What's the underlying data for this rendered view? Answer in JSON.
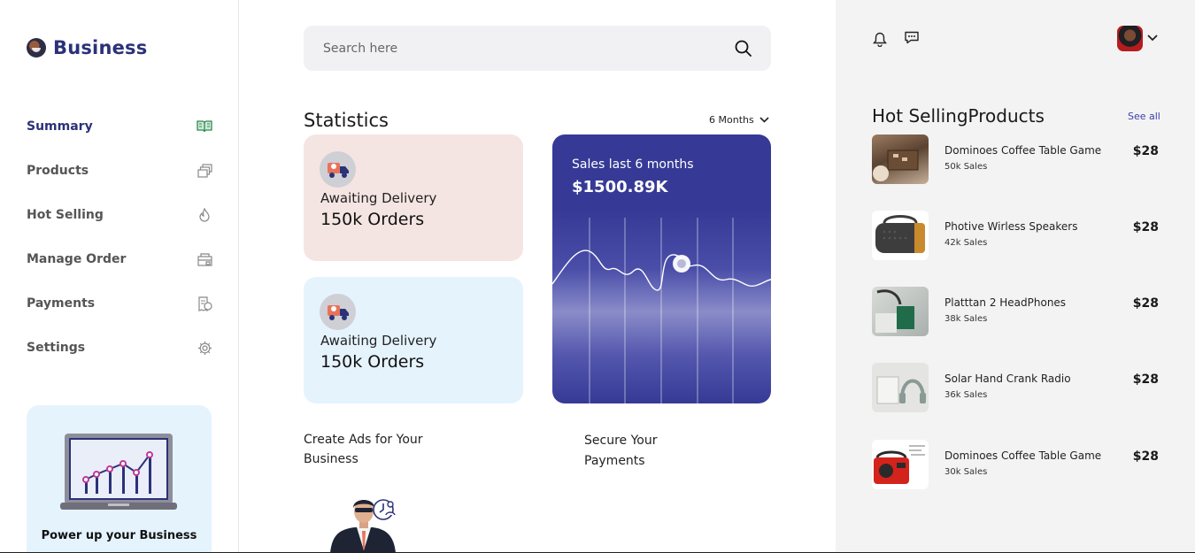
{
  "brand": {
    "name": "Business"
  },
  "sidebar": {
    "items": [
      {
        "label": "Summary",
        "icon": "book-open-icon",
        "active": true
      },
      {
        "label": "Products",
        "icon": "stack-icon",
        "active": false
      },
      {
        "label": "Hot Selling",
        "icon": "flame-icon",
        "active": false
      },
      {
        "label": "Manage Order",
        "icon": "cart-box-icon",
        "active": false
      },
      {
        "label": "Payments",
        "icon": "receipt-icon",
        "active": false
      },
      {
        "label": "Settings",
        "icon": "gear-icon",
        "active": false
      }
    ],
    "promo": {
      "title": "Power up your Business"
    }
  },
  "search": {
    "placeholder": "Search here"
  },
  "statistics": {
    "title": "Statistics",
    "period": "6 Months",
    "cards": [
      {
        "label": "Awaiting Delivery",
        "value": "150k Orders",
        "color": "#f5e5e2"
      },
      {
        "label": "Awaiting Delivery",
        "value": "150k Orders",
        "color": "#e5f3fd"
      }
    ],
    "sales": {
      "label": "Sales last 6 months",
      "value": "$1500.89K"
    }
  },
  "promos": {
    "ads": "Create Ads for Your Business",
    "payments": "Secure Your Payments"
  },
  "right_panel": {
    "hot_title": "Hot SellingProducts",
    "see_all": "See all",
    "products": [
      {
        "name": "Dominoes Coffee Table Game",
        "sales": "50k Sales",
        "price": "$28"
      },
      {
        "name": "Photive Wirless Speakers",
        "sales": "42k Sales",
        "price": "$28"
      },
      {
        "name": "Platttan 2 HeadPhones",
        "sales": "38k Sales",
        "price": "$28"
      },
      {
        "name": "Solar Hand Crank Radio",
        "sales": "36k Sales",
        "price": "$28"
      },
      {
        "name": "Dominoes Coffee Table Game",
        "sales": "30k Sales",
        "price": "$28"
      }
    ]
  },
  "colors": {
    "accent": "#2b3278",
    "chart_bg": "#363a96",
    "sidebar_promo": "#e5f3fd"
  }
}
